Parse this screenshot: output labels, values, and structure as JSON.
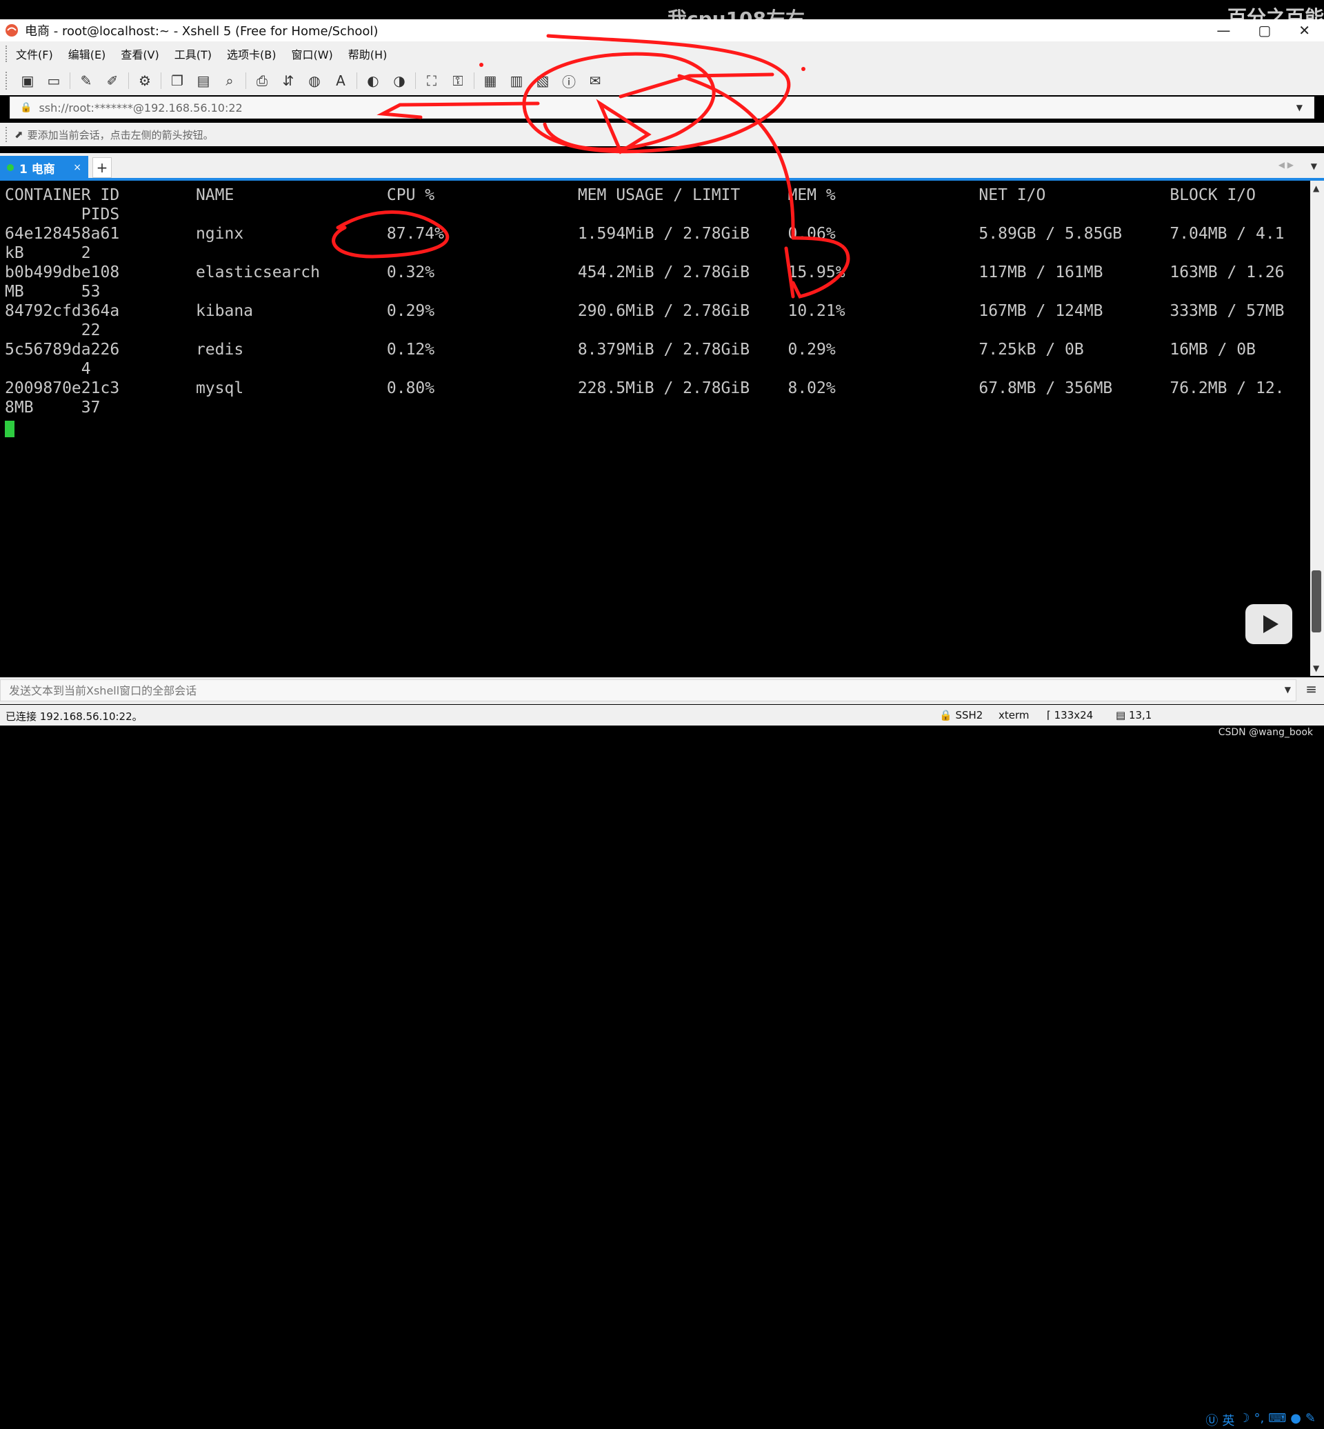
{
  "overlay": {
    "like_text": "我cpu108左右",
    "corner_text": "百分之百能",
    "watermark": "CSDN @wang_book"
  },
  "title": {
    "text": "电商 - root@localhost:~ - Xshell 5 (Free for Home/School)"
  },
  "window_controls": [
    "—",
    "▢",
    "✕"
  ],
  "menu": [
    "文件(F)",
    "编辑(E)",
    "查看(V)",
    "工具(T)",
    "选项卡(B)",
    "窗口(W)",
    "帮助(H)"
  ],
  "address": {
    "value": "ssh://root:*******@192.168.56.10:22"
  },
  "session_hint": "要添加当前会话，点击左侧的箭头按钮。",
  "tabs": [
    {
      "label": "1 电商",
      "close": "×"
    }
  ],
  "add_tab": "+",
  "terminal": {
    "lines": [
      "CONTAINER ID        NAME                CPU %               MEM USAGE / LIMIT     MEM %               NET I/O             BLOCK I/O",
      "        PIDS",
      "64e128458a61        nginx               87.74%              1.594MiB / 2.78GiB    0.06%               5.89GB / 5.85GB     7.04MB / 4.1",
      "kB      2",
      "b0b499dbe108        elasticsearch       0.32%               454.2MiB / 2.78GiB    15.95%              117MB / 161MB       163MB / 1.26",
      "MB      53",
      "84792cfd364a        kibana              0.29%               290.6MiB / 2.78GiB    10.21%              167MB / 124MB       333MB / 57MB",
      "        22",
      "5c56789da226        redis               0.12%               8.379MiB / 2.78GiB    0.29%               7.25kB / 0B         16MB / 0B",
      "        4",
      "2009870e21c3        mysql               0.80%               228.5MiB / 2.78GiB    8.02%               67.8MB / 356MB      76.2MB / 12.",
      "8MB     37"
    ]
  },
  "send_bar": {
    "placeholder": "发送文本到当前Xshell窗口的全部会话"
  },
  "status": {
    "connected": "已连接 192.168.56.10:22。",
    "protocol": "SSH2",
    "term": "xterm",
    "size": "133x24",
    "position": "13,1",
    "ime_label": "英"
  },
  "colors": {
    "accent": "#1e88e5",
    "cursor": "#2ecc40",
    "annotation": "#ff1a1a"
  }
}
